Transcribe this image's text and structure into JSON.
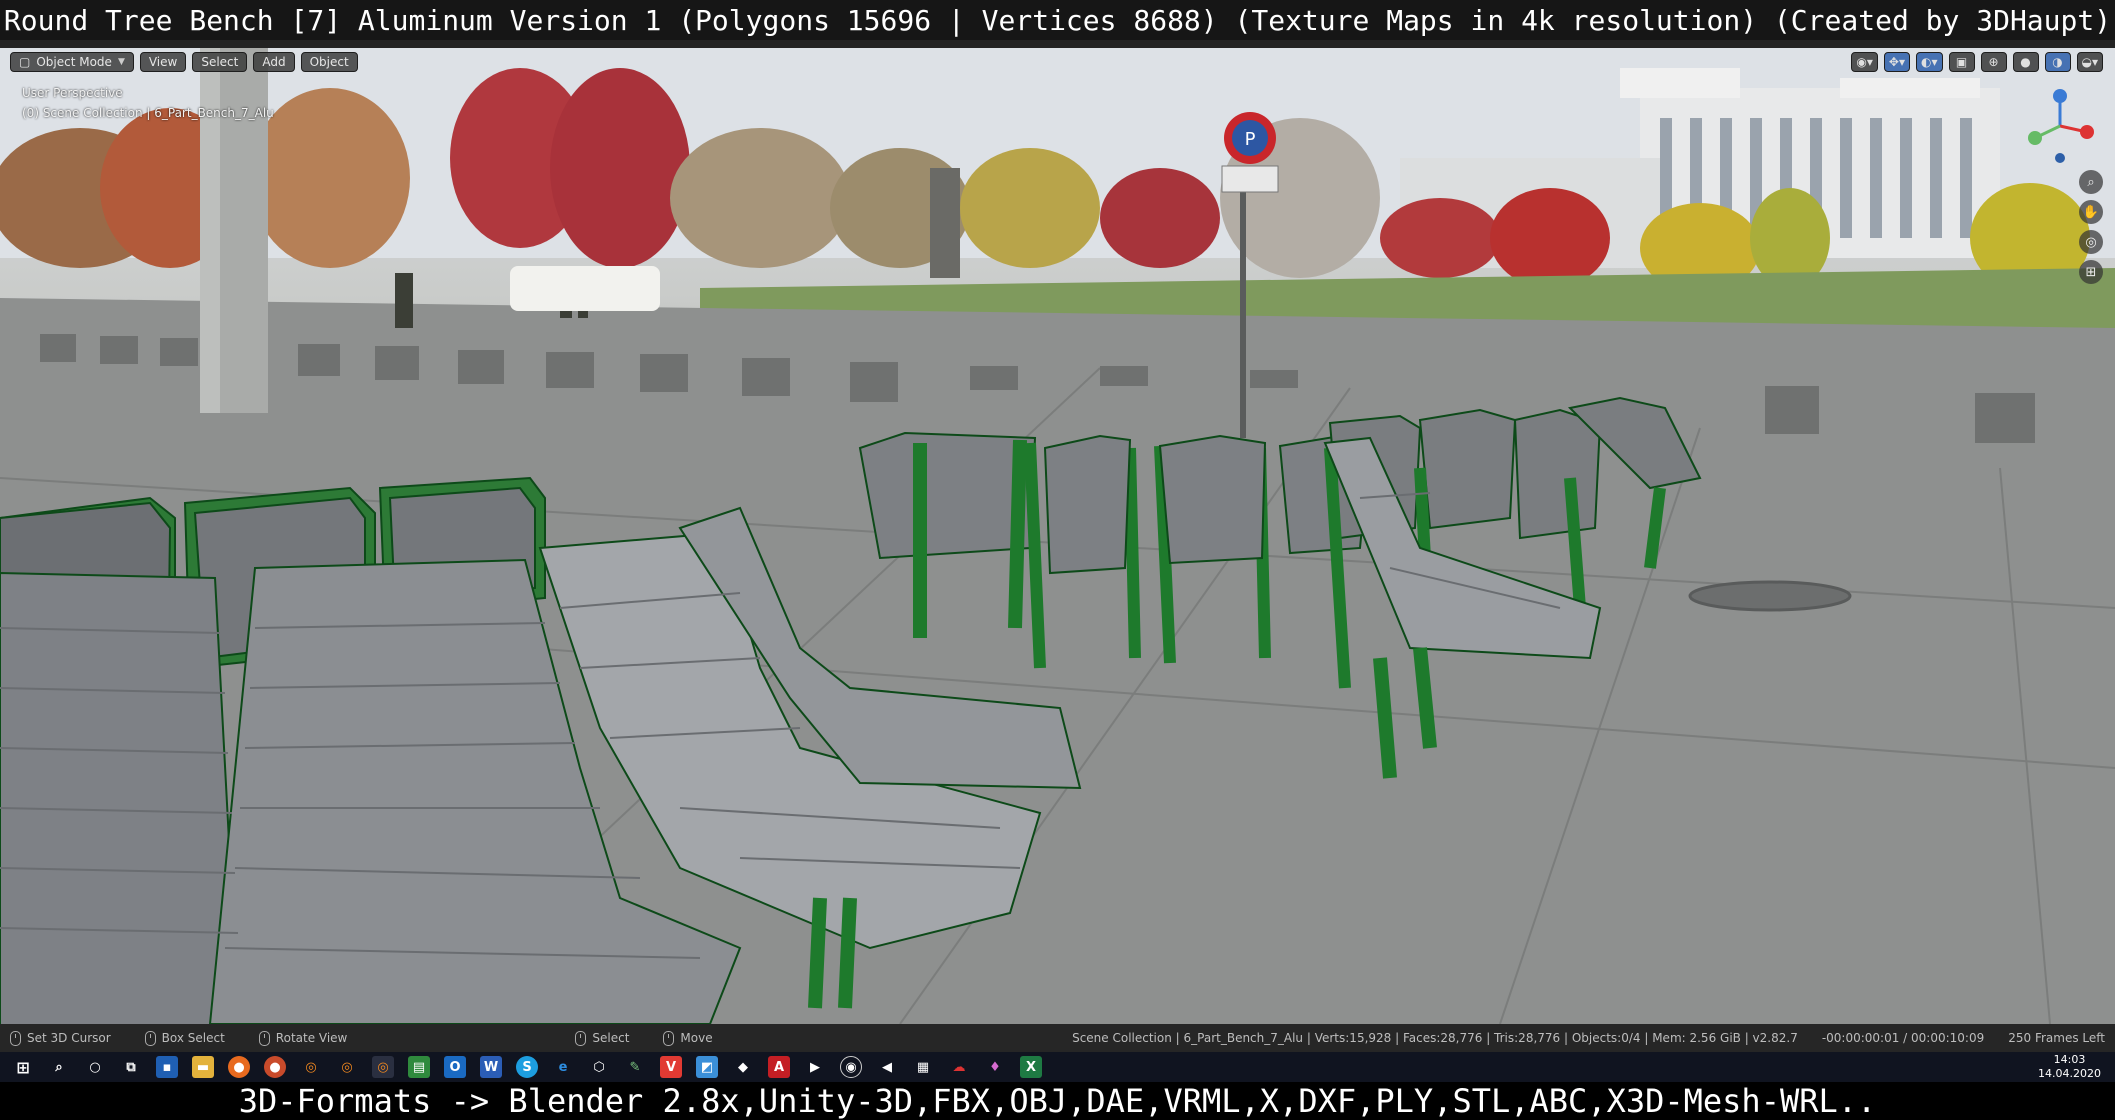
{
  "caption_top": "Round Tree Bench [7] Aluminum Version 1 (Polygons 15696 | Vertices 8688) (Texture Maps in 4k resolution) (Created by 3DHaupt)",
  "caption_bottom": "3D-Formats -> Blender 2.8x,Unity-3D,FBX,OBJ,DAE,VRML,X,DXF,PLY,STL,ABC,X3D-Mesh-WRL..",
  "viewport_header": {
    "mode": "Object Mode",
    "menus": [
      "View",
      "Select",
      "Add",
      "Object"
    ]
  },
  "viewport_info": {
    "perspective": "User Perspective",
    "collection": "(0) Scene Collection | 6_Part_Bench_7_Alu"
  },
  "scene": {
    "sign_text": "P"
  },
  "statusbar": {
    "items": [
      {
        "icon": "mouse-left-icon",
        "label": "Set 3D Cursor"
      },
      {
        "icon": "mouse-left-icon",
        "label": "Box Select"
      },
      {
        "icon": "mouse-middle-icon",
        "label": "Rotate View"
      },
      {
        "icon": "mouse-left-icon",
        "label": "Select"
      },
      {
        "icon": "mouse-left-icon",
        "label": "Move"
      }
    ],
    "scene_stats": "Scene Collection | 6_Part_Bench_7_Alu | Verts:15,928 | Faces:28,776 | Tris:28,776 | Objects:0/4 | Mem: 2.56 GiB | v2.82.7",
    "timecode": "-00:00:00:01 / 00:00:10:09",
    "frames_left": "250 Frames Left"
  },
  "taskbar": {
    "time": "14:03",
    "date": "14.04.2020"
  },
  "colors": {
    "frame_green": "#1e7a2c",
    "seat_gray": "#8d9094",
    "accent_blue": "#4772b3"
  }
}
